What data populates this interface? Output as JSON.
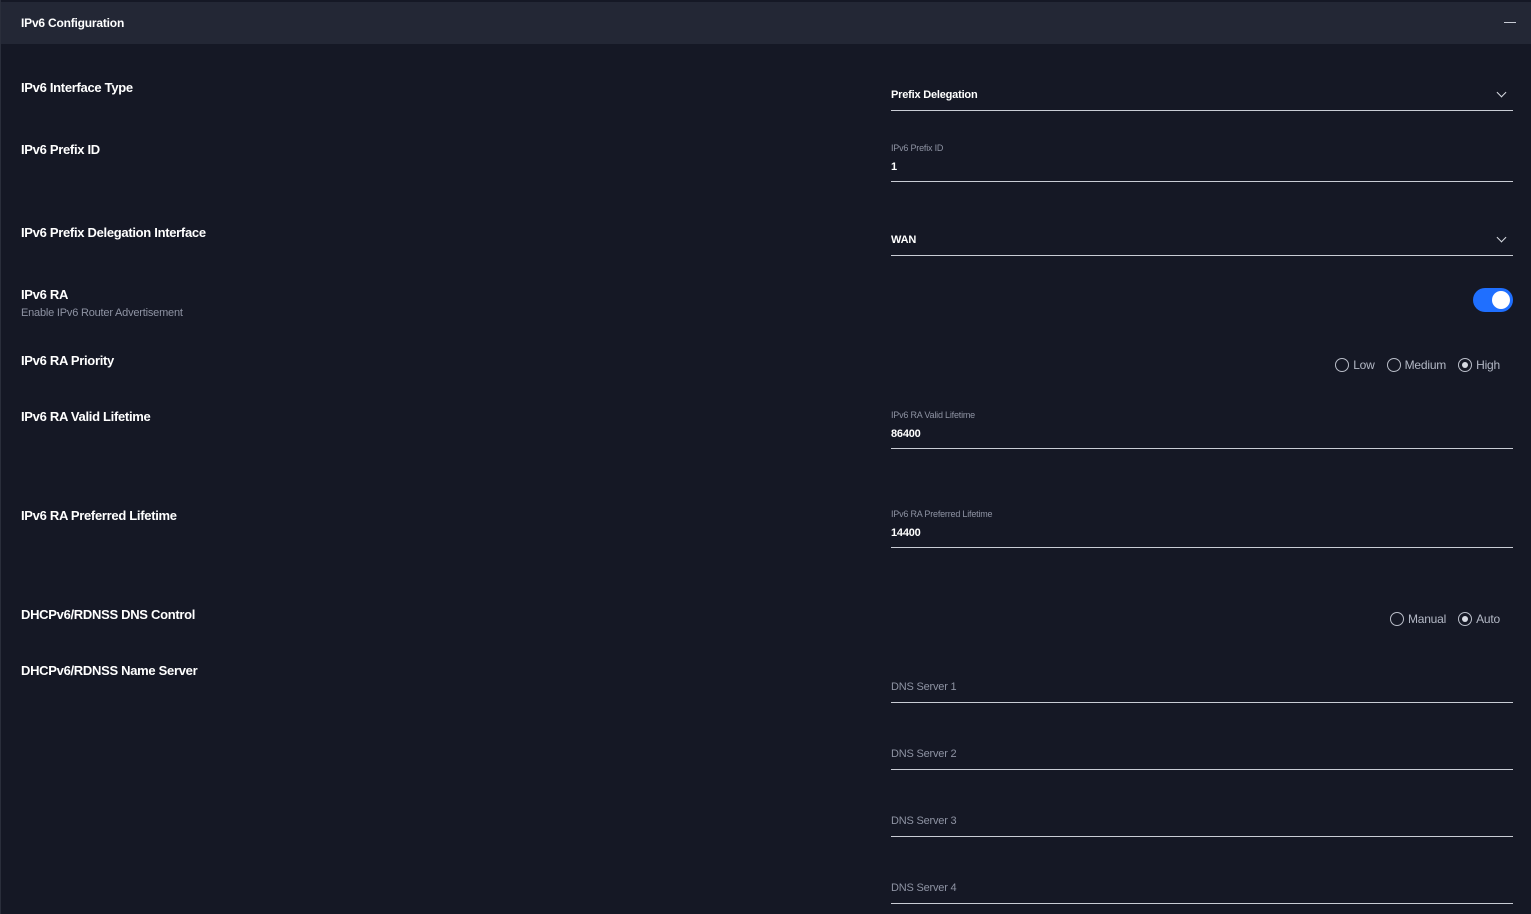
{
  "header": {
    "title": "IPv6 Configuration",
    "collapse_icon": "minus-icon"
  },
  "rows": {
    "interface_type": {
      "label": "IPv6 Interface Type",
      "value": "Prefix Delegation"
    },
    "prefix_id": {
      "label": "IPv6 Prefix ID",
      "field_label": "IPv6 Prefix ID",
      "value": "1"
    },
    "pd_interface": {
      "label": "IPv6 Prefix Delegation Interface",
      "value": "WAN"
    },
    "ra": {
      "label": "IPv6 RA",
      "sublabel": "Enable IPv6 Router Advertisement",
      "enabled": true
    },
    "ra_priority": {
      "label": "IPv6 RA Priority",
      "options": [
        "Low",
        "Medium",
        "High"
      ],
      "selected": "High"
    },
    "ra_valid_lifetime": {
      "label": "IPv6 RA Valid Lifetime",
      "field_label": "IPv6 RA Valid Lifetime",
      "value": "86400"
    },
    "ra_preferred_lifetime": {
      "label": "IPv6 RA Preferred Lifetime",
      "field_label": "IPv6 RA Preferred Lifetime",
      "value": "14400"
    },
    "dns_control": {
      "label": "DHCPv6/RDNSS DNS Control",
      "options": [
        "Manual",
        "Auto"
      ],
      "selected": "Auto"
    },
    "name_server": {
      "label": "DHCPv6/RDNSS Name Server",
      "placeholders": [
        "DNS Server 1",
        "DNS Server 2",
        "DNS Server 3",
        "DNS Server 4"
      ]
    }
  },
  "colors": {
    "background": "#151825",
    "header_bg": "#232735",
    "accent": "#1f6fff"
  }
}
